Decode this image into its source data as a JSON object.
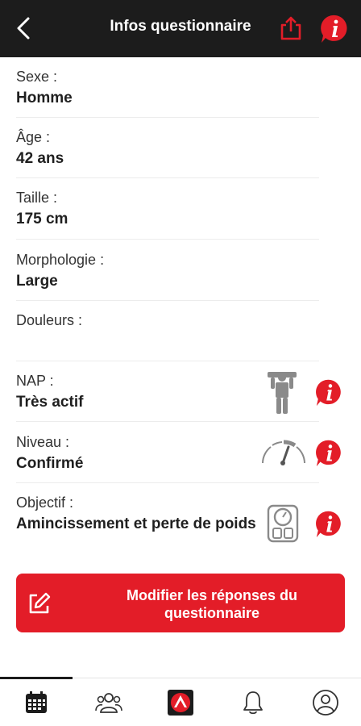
{
  "header": {
    "title": "Infos questionnaire",
    "back_icon": "chevron-left-icon",
    "share_icon": "share-icon",
    "info_icon": "info-bubble-icon"
  },
  "fields": [
    {
      "label": "Sexe :",
      "value": "Homme"
    },
    {
      "label": "Âge :",
      "value": "42 ans"
    },
    {
      "label": "Taille :",
      "value": "175 cm"
    },
    {
      "label": "Morphologie :",
      "value": "Large"
    },
    {
      "label": "Douleurs :",
      "value": ""
    },
    {
      "label": "NAP :",
      "value": "Très actif"
    },
    {
      "label": "Niveau :",
      "value": "Confirmé"
    },
    {
      "label": "Objectif :",
      "value": "Amincissement et perte de poids"
    }
  ],
  "row_icons": {
    "nap": "active-person-icon",
    "niveau": "gauge-icon",
    "objectif": "scale-icon"
  },
  "edit_button": {
    "label": "Modifier les réponses du questionnaire",
    "icon": "edit-icon"
  },
  "tabbar": {
    "items": [
      "calendar-icon",
      "group-icon",
      "brand-logo-icon",
      "bell-icon",
      "profile-icon"
    ],
    "active_index": 0
  },
  "colors": {
    "header_bg": "#1c1c1c",
    "accent_red": "#e31d28",
    "icon_gray": "#8a8a8a"
  }
}
